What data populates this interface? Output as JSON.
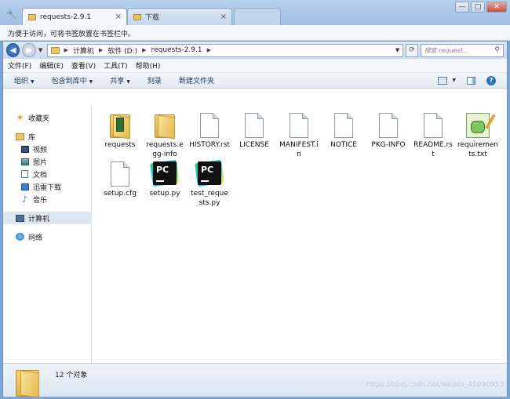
{
  "browser": {
    "tabs": [
      {
        "title": "requests-2.9.1",
        "close": "×"
      },
      {
        "title": "下载",
        "close": "×"
      }
    ],
    "bookmark_prompt": "为便于访问，可将书签放置在书签栏中。",
    "window_controls": {
      "minimize": "—",
      "maximize": "□",
      "close": "✕"
    }
  },
  "address": {
    "crumbs": [
      "计算机",
      "软件 (D:)",
      "requests-2.9.1"
    ],
    "search_placeholder": "搜索 request..."
  },
  "menu": [
    "文件(F)",
    "编辑(E)",
    "查看(V)",
    "工具(T)",
    "帮助(H)"
  ],
  "toolbar": {
    "organize": "组织",
    "include_library": "包含到库中",
    "share": "共享",
    "burn": "刻录",
    "new_folder": "新建文件夹",
    "help": "?"
  },
  "navpane": {
    "favorites": "收藏夹",
    "libraries": "库",
    "lib_items": [
      "视频",
      "图片",
      "文档",
      "迅雷下载",
      "音乐"
    ],
    "computer": "计算机",
    "network": "网络"
  },
  "files": [
    {
      "name": "requests",
      "icon": "folder-icon"
    },
    {
      "name": "requests.egg-info",
      "icon": "folder-icon"
    },
    {
      "name": "HISTORY.rst",
      "icon": "file-icon"
    },
    {
      "name": "LICENSE",
      "icon": "file-icon"
    },
    {
      "name": "MANIFEST.in",
      "icon": "file-icon"
    },
    {
      "name": "NOTICE",
      "icon": "file-icon"
    },
    {
      "name": "PKG-INFO",
      "icon": "file-icon"
    },
    {
      "name": "README.rst",
      "icon": "file-icon"
    },
    {
      "name": "requirements.txt",
      "icon": "notepad-icon"
    },
    {
      "name": "setup.cfg",
      "icon": "file-icon"
    },
    {
      "name": "setup.py",
      "icon": "pycharm-icon"
    },
    {
      "name": "test_requests.py",
      "icon": "pycharm-icon"
    }
  ],
  "details": {
    "count": "12 个对象"
  },
  "watermark": "https://blog.csdn.net/weixin_41090953"
}
